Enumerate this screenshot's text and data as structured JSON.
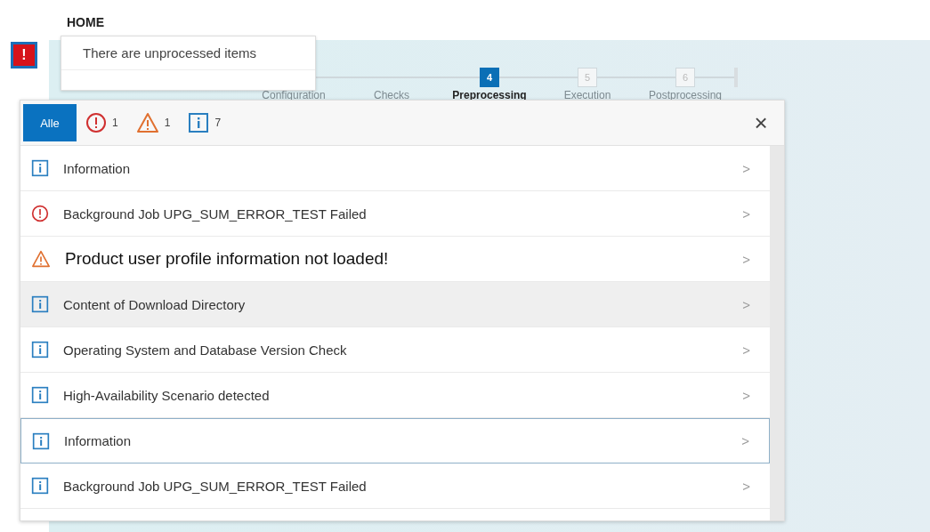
{
  "header": {
    "title": "HOME"
  },
  "alert_button": {
    "symbol": "!"
  },
  "tooltip": {
    "text": "There are unprocessed items"
  },
  "steps": [
    {
      "label": "Configuration",
      "current": false
    },
    {
      "label": "Checks",
      "current": false
    },
    {
      "number": "4",
      "label": "Preprocessing",
      "current": true
    },
    {
      "number": "5",
      "label": "Execution",
      "current": false
    },
    {
      "number": "6",
      "label": "Postprocessing",
      "current": false
    }
  ],
  "messages_popover": {
    "filters": [
      {
        "kind": "all",
        "label": "Alle",
        "selected": true
      },
      {
        "kind": "error",
        "count": "1",
        "selected": false
      },
      {
        "kind": "warning",
        "count": "1",
        "selected": false
      },
      {
        "kind": "info",
        "count": "7",
        "selected": false
      }
    ],
    "close": "×",
    "items": [
      {
        "kind": "info",
        "text": "Information",
        "selected": false,
        "focused": false
      },
      {
        "kind": "error",
        "text": "Background Job UPG_SUM_ERROR_TEST Failed",
        "selected": false,
        "focused": false
      },
      {
        "kind": "warning",
        "text": "Product user profile  information  not loaded!",
        "selected": false,
        "focused": false
      },
      {
        "kind": "info",
        "text": "Content of Download Directory",
        "selected": true,
        "focused": false
      },
      {
        "kind": "info",
        "text": "Operating System and Database Version Check",
        "selected": false,
        "focused": false
      },
      {
        "kind": "info",
        "text": "High-Availability Scenario detected",
        "selected": false,
        "focused": false
      },
      {
        "kind": "info",
        "text": "Information",
        "selected": false,
        "focused": true
      },
      {
        "kind": "info",
        "text": "Background Job UPG_SUM_ERROR_TEST Failed",
        "selected": false,
        "focused": false
      }
    ],
    "chevron": ">"
  }
}
